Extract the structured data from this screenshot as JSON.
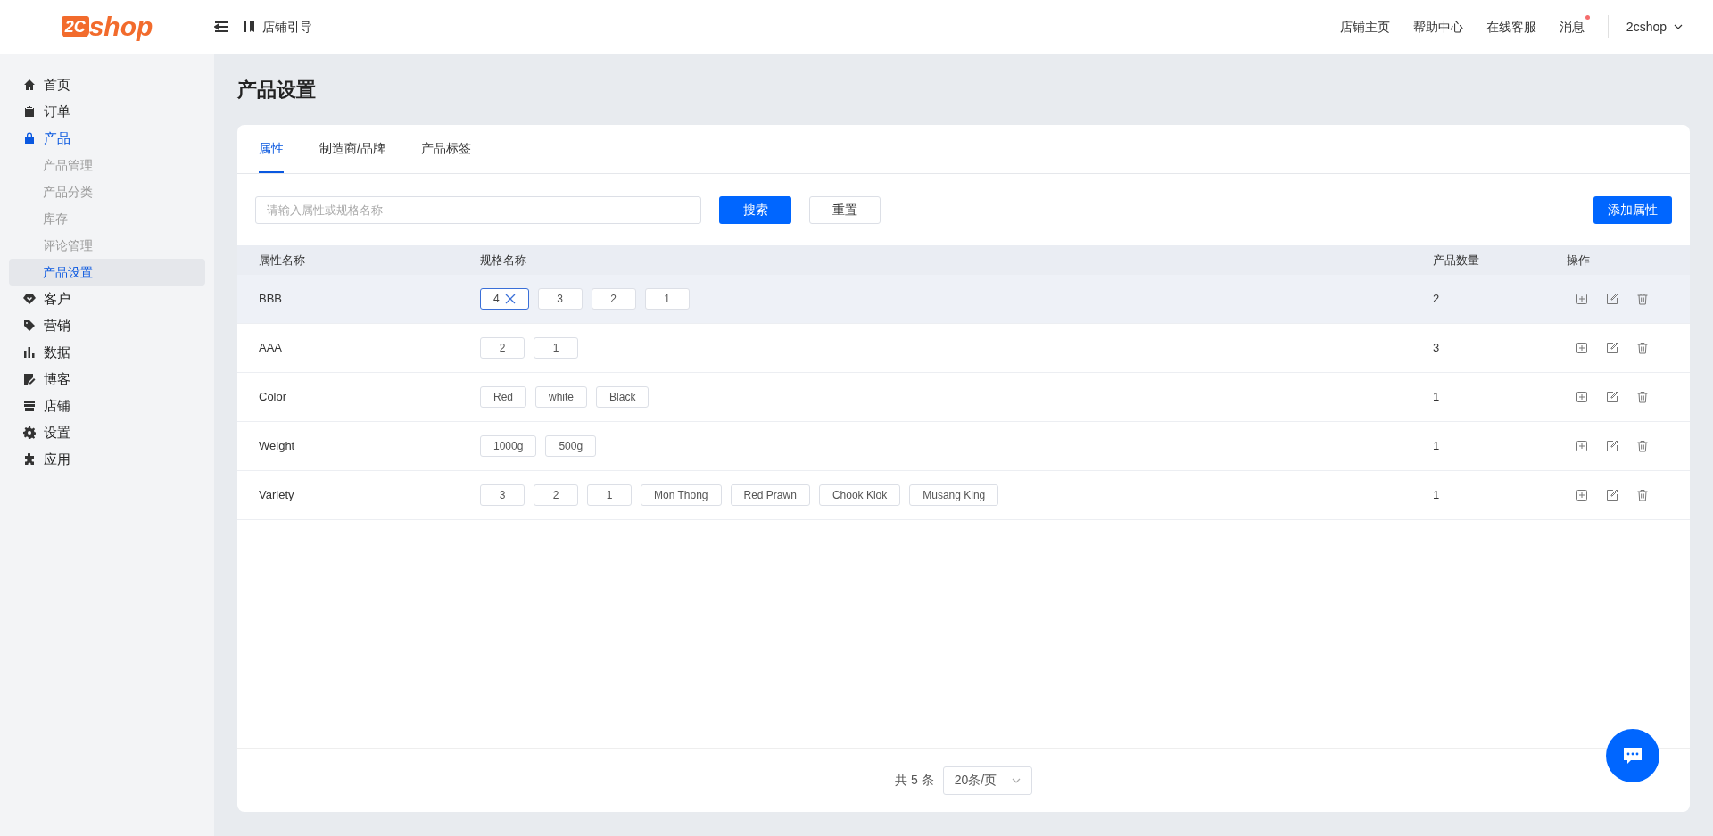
{
  "header": {
    "logo": {
      "mark": "2C",
      "text": "shop"
    },
    "guide": "店铺引导",
    "links": [
      {
        "label": "店铺主页",
        "badge": false
      },
      {
        "label": "帮助中心",
        "badge": false
      },
      {
        "label": "在线客服",
        "badge": false
      },
      {
        "label": "消息",
        "badge": true
      }
    ],
    "user": "2cshop"
  },
  "sidebar": {
    "items": [
      {
        "label": "首页",
        "kind": "home",
        "selected": false
      },
      {
        "label": "订单",
        "kind": "clipboard",
        "selected": false
      },
      {
        "label": "产品",
        "kind": "bag",
        "selected": true,
        "children": [
          {
            "label": "产品管理",
            "selected": false
          },
          {
            "label": "产品分类",
            "selected": false
          },
          {
            "label": "库存",
            "selected": false
          },
          {
            "label": "评论管理",
            "selected": false
          },
          {
            "label": "产品设置",
            "selected": true
          }
        ]
      },
      {
        "label": "客户",
        "kind": "gem",
        "selected": false
      },
      {
        "label": "营销",
        "kind": "tag",
        "selected": false
      },
      {
        "label": "数据",
        "kind": "chart",
        "selected": false
      },
      {
        "label": "博客",
        "kind": "edit",
        "selected": false
      },
      {
        "label": "店铺",
        "kind": "store",
        "selected": false
      },
      {
        "label": "设置",
        "kind": "gear",
        "selected": false
      },
      {
        "label": "应用",
        "kind": "puzzle",
        "selected": false
      }
    ]
  },
  "page_title": "产品设置",
  "tabs": [
    {
      "label": "属性",
      "selected": true
    },
    {
      "label": "制造商/品牌",
      "selected": false
    },
    {
      "label": "产品标签",
      "selected": false
    }
  ],
  "search": {
    "placeholder": "请输入属性或规格名称",
    "search_button": "搜索",
    "reset_button": "重置",
    "add_button": "添加属性"
  },
  "table": {
    "columns": [
      "属性名称",
      "规格名称",
      "产品数量",
      "操作"
    ],
    "rows": [
      {
        "name": "BBB",
        "selected": true,
        "count": "2",
        "specs": [
          {
            "label": "4",
            "selected": true
          },
          {
            "label": "3",
            "selected": false
          },
          {
            "label": "2",
            "selected": false
          },
          {
            "label": "1",
            "selected": false
          }
        ]
      },
      {
        "name": "AAA",
        "selected": false,
        "count": "3",
        "specs": [
          {
            "label": "2",
            "selected": false
          },
          {
            "label": "1",
            "selected": false
          }
        ]
      },
      {
        "name": "Color",
        "selected": false,
        "count": "1",
        "specs": [
          {
            "label": "Red",
            "selected": false
          },
          {
            "label": "white",
            "selected": false
          },
          {
            "label": "Black",
            "selected": false
          }
        ]
      },
      {
        "name": "Weight",
        "selected": false,
        "count": "1",
        "specs": [
          {
            "label": "1000g",
            "selected": false
          },
          {
            "label": "500g",
            "selected": false
          }
        ]
      },
      {
        "name": "Variety",
        "selected": false,
        "count": "1",
        "specs": [
          {
            "label": "3",
            "selected": false
          },
          {
            "label": "2",
            "selected": false
          },
          {
            "label": "1",
            "selected": false
          },
          {
            "label": "Mon Thong",
            "selected": false
          },
          {
            "label": "Red Prawn",
            "selected": false
          },
          {
            "label": "Chook Kiok",
            "selected": false
          },
          {
            "label": "Musang King",
            "selected": false
          }
        ]
      }
    ]
  },
  "pagination": {
    "total": "共 5 条",
    "page_size": "20条/页"
  }
}
